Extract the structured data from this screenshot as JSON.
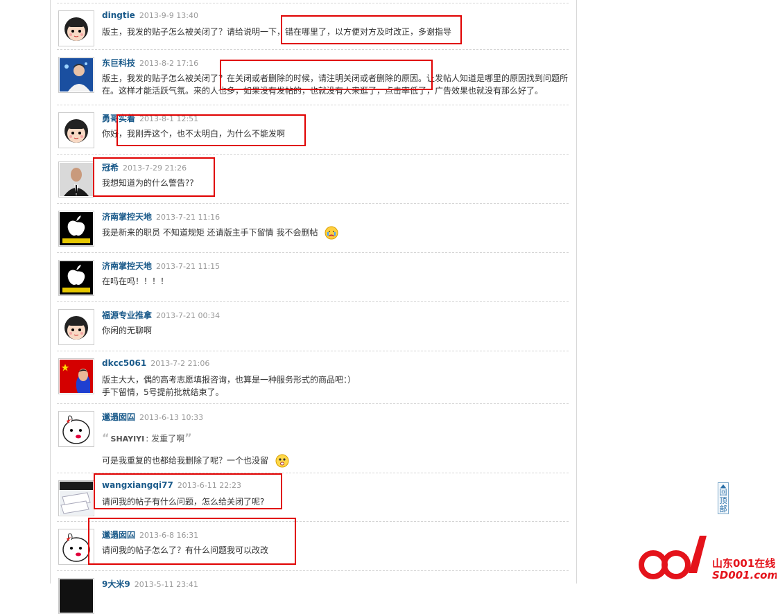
{
  "comments": [
    {
      "author": "dingtie",
      "time": "2013-9-9 13:40",
      "lines": [
        "版主，我发的贴子怎么被关闭了？请给说明一下，错在哪里了，以方便对方及时改正，多谢指导"
      ],
      "avatar": "cartoon-girl"
    },
    {
      "author": "东巨科技",
      "time": "2013-8-2 17:16",
      "lines": [
        "版主，我发的贴子怎么被关闭了？在关闭或者删除的时候，请注明关闭或者删除的原因。让发帖人知道是哪里的原因找到问题所在。这样才能活跃气氛。来的人也多，如果没有发帖的，也就没有人来逛了，点击率低了，广告效果也就没有那么好了。"
      ],
      "avatar": "photo-man-blue"
    },
    {
      "author": "勇哥实着",
      "time": "2013-8-1 12:51",
      "lines": [
        "你好，我刚弄这个，也不太明白，为什么不能发啊"
      ],
      "avatar": "cartoon-girl"
    },
    {
      "author": "冠希",
      "time": "2013-7-29 21:26",
      "lines": [
        "我想知道为的什么警告??"
      ],
      "avatar": "photo-man-suit"
    },
    {
      "author": "济南掌控天地",
      "time": "2013-7-21 11:16",
      "lines": [
        "我是新来的职员 不知道规矩 还请版主手下留情 我不会删帖"
      ],
      "emoji": "crying-face",
      "avatar": "apple-logo"
    },
    {
      "author": "济南掌控天地",
      "time": "2013-7-21 11:15",
      "lines": [
        "在吗在吗！！！！"
      ],
      "avatar": "apple-logo"
    },
    {
      "author": "福源专业推拿",
      "time": "2013-7-21 00:34",
      "lines": [
        "你闲的无聊啊"
      ],
      "avatar": "cartoon-girl"
    },
    {
      "author": "dkcc5061",
      "time": "2013-7-2 21:06",
      "lines": [
        "版主大大，偶的高考志愿填报咨询，也算是一种服务形式的商品吧：）",
        "手下留情，5号提前批就结束了。"
      ],
      "avatar": "flag-portrait"
    },
    {
      "author": "邋遢囡囜",
      "time": "2013-6-13 10:33",
      "quote_author": "SHAYIYI",
      "quote_text": "发重了啊",
      "lines": [
        "可是我重复的也都给我删除了呢？一个也没留"
      ],
      "emoji": "confused-face",
      "avatar": "bunny-face"
    },
    {
      "author": "wangxiangqi77",
      "time": "2013-6-11 22:23",
      "lines": [
        "请问我的帖子有什么问题，怎么给关闭了呢?"
      ],
      "avatar": "photo-papers"
    },
    {
      "author": "邋遢囡囜",
      "time": "2013-6-8 16:31",
      "lines": [
        "请问我的帖子怎么了？有什么问题我可以改改"
      ],
      "avatar": "bunny-face"
    },
    {
      "author": "9大米9",
      "time": "2013-5-11 23:41",
      "lines": [],
      "avatar": "photo-dark"
    }
  ],
  "back_to_top": {
    "label": "回顶部"
  },
  "watermark": {
    "brand": "山东001在线",
    "domain": "SD001.com"
  },
  "colors": {
    "author": "#1a5a8a",
    "highlight": "#e00000"
  }
}
